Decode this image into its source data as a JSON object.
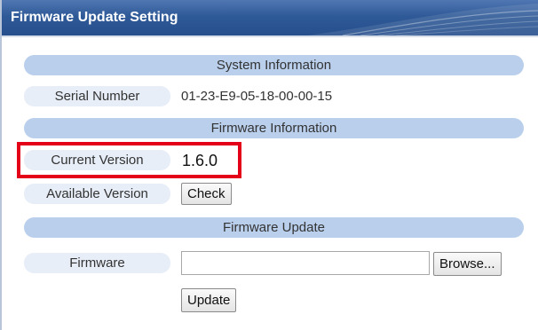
{
  "panel": {
    "title": "Firmware Update Setting"
  },
  "system_info": {
    "section_title": "System Information",
    "serial_label": "Serial Number",
    "serial_value": "01-23-E9-05-18-00-00-15"
  },
  "firmware_info": {
    "section_title": "Firmware Information",
    "current_label": "Current Version",
    "current_value": "1.6.0",
    "available_label": "Available Version",
    "check_button": "Check"
  },
  "firmware_update": {
    "section_title": "Firmware Update",
    "firmware_label": "Firmware",
    "file_value": "",
    "browse_button": "Browse...",
    "update_button": "Update"
  },
  "colors": {
    "header": "#2f5a98",
    "section_bar": "#b9cfec",
    "label_bg": "#e8eef8",
    "highlight": "#e5001a"
  }
}
